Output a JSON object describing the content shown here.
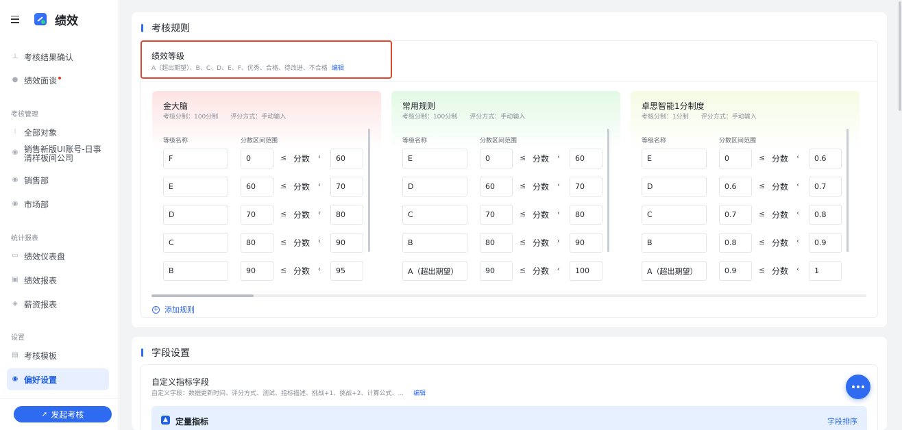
{
  "app": {
    "name": "绩效"
  },
  "sidebar": {
    "items_top": [
      {
        "label": "考核结果确认",
        "icon": "stamp-icon"
      },
      {
        "label": "绩效面谈",
        "icon": "chat-icon",
        "dot": true
      }
    ],
    "sections": [
      {
        "title": "考核管理",
        "items": [
          {
            "label": "全部对象",
            "icon": "grid-icon"
          },
          {
            "label": "销售新版UI账号-日事清样板间公司",
            "icon": "shield-icon"
          },
          {
            "label": "销售部",
            "icon": "shield-icon"
          },
          {
            "label": "市场部",
            "icon": "shield-icon"
          }
        ]
      },
      {
        "title": "统计报表",
        "items": [
          {
            "label": "绩效仪表盘",
            "icon": "monitor-icon"
          },
          {
            "label": "绩效报表",
            "icon": "report-icon"
          },
          {
            "label": "薪资报表",
            "icon": "wallet-icon"
          }
        ]
      },
      {
        "title": "设置",
        "items": [
          {
            "label": "考核模板",
            "icon": "template-icon"
          },
          {
            "label": "偏好设置",
            "icon": "settings-icon",
            "active": true
          }
        ]
      }
    ],
    "launch_button": "发起考核"
  },
  "rules_panel": {
    "title": "考核规则",
    "grade": {
      "title": "绩效等级",
      "desc": "A（超出期望）、B、C、D、E、F、优秀、合格、待改进、不合格",
      "edit": "编辑"
    },
    "column_headers": {
      "name": "等级名称",
      "range": "分数区间范围"
    },
    "symbols": {
      "le": "≤",
      "score": "分数",
      "lt": "‹"
    },
    "cards": [
      {
        "name": "金大脑",
        "scale": "考核分制：100分制",
        "method": "评分方式：手动输入",
        "color": "#fde3e3",
        "rows": [
          {
            "name": "F",
            "lo": "0",
            "hi": "60"
          },
          {
            "name": "E",
            "lo": "60",
            "hi": "70"
          },
          {
            "name": "D",
            "lo": "70",
            "hi": "80"
          },
          {
            "name": "C",
            "lo": "80",
            "hi": "90"
          },
          {
            "name": "B",
            "lo": "90",
            "hi": "95"
          }
        ]
      },
      {
        "name": "常用规则",
        "scale": "考核分制：100分制",
        "method": "评分方式：手动输入",
        "color": "#e2f9e4",
        "rows": [
          {
            "name": "E",
            "lo": "0",
            "hi": "60"
          },
          {
            "name": "D",
            "lo": "60",
            "hi": "70"
          },
          {
            "name": "C",
            "lo": "70",
            "hi": "80"
          },
          {
            "name": "B",
            "lo": "80",
            "hi": "90"
          },
          {
            "name": "A（超出期望）",
            "lo": "90",
            "hi": "100"
          }
        ]
      },
      {
        "name": "卓思智能1分制度",
        "scale": "考核分制：1分制",
        "method": "评分方式：手动输入",
        "color": "#f5fbe3",
        "rows": [
          {
            "name": "E",
            "lo": "0",
            "hi": "0.6"
          },
          {
            "name": "D",
            "lo": "0.6",
            "hi": "0.7"
          },
          {
            "name": "C",
            "lo": "0.7",
            "hi": "0.8"
          },
          {
            "name": "B",
            "lo": "0.8",
            "hi": "0.9"
          },
          {
            "name": "A（超出期望）",
            "lo": "0.9",
            "hi": "1"
          }
        ]
      }
    ],
    "add_rule": "添加规则"
  },
  "fields_panel": {
    "title": "字段设置",
    "custom": {
      "title": "自定义指标字段",
      "desc": "自定义字段：数据更新时间、评分方式、测试、指标描述、挑战+1、挑战+2、计算公式、...",
      "edit": "编辑"
    },
    "quant": {
      "title": "定量指标",
      "sort": "字段排序"
    }
  },
  "colors": {
    "accent": "#2f6bf0",
    "highlight_border": "#e0442d"
  }
}
